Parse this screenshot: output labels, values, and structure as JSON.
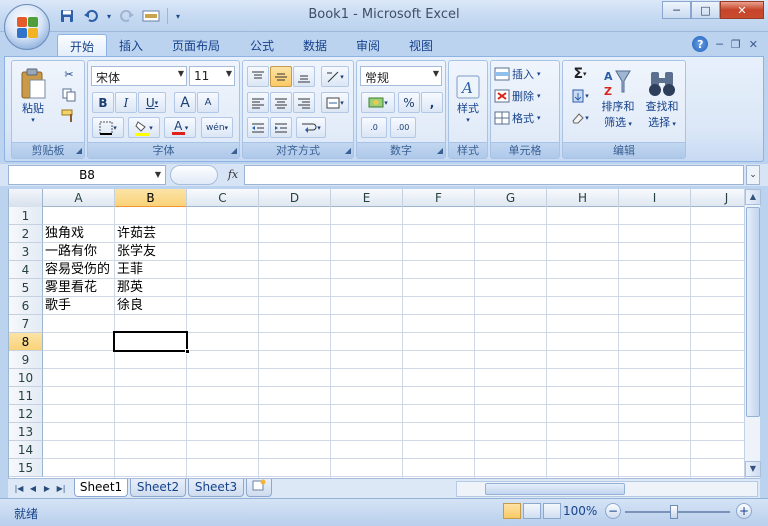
{
  "window": {
    "title": "Book1 - Microsoft Excel"
  },
  "quick_access": {
    "undo_arrow": "▾",
    "customize_arrow": "▾"
  },
  "window_controls": {
    "minimize": "─",
    "restore": "□",
    "close": "✕"
  },
  "ribbon_tabs": [
    "开始",
    "插入",
    "页面布局",
    "公式",
    "数据",
    "审阅",
    "视图"
  ],
  "ribbon_right": {
    "help": "?",
    "minimize": "─",
    "restore": "❐",
    "close": "✕"
  },
  "groups": {
    "clipboard": {
      "label": "剪贴板",
      "paste": "粘贴"
    },
    "font": {
      "label": "字体",
      "font_name": "宋体",
      "font_size": "11",
      "bold": "B",
      "italic": "I",
      "underline": "U",
      "grow": "A",
      "shrink": "A",
      "phonetic": "wén"
    },
    "alignment": {
      "label": "对齐方式"
    },
    "number": {
      "label": "数字",
      "format": "常规",
      "percent": "%",
      "comma": ",",
      "inc_decimal": ".0",
      "dec_decimal": ".00"
    },
    "styles": {
      "label": "样式",
      "button": "样式"
    },
    "cells": {
      "label": "单元格",
      "insert": "插入",
      "delete": "删除",
      "format": "格式"
    },
    "editing": {
      "label": "编辑",
      "sort_filter": "排序和",
      "sort_filter_2": "筛选",
      "find_select": "查找和",
      "find_select_2": "选择",
      "sigma": "Σ"
    }
  },
  "formula_bar": {
    "name_box": "B8",
    "fx": "fx",
    "content": ""
  },
  "grid": {
    "columns": [
      "A",
      "B",
      "C",
      "D",
      "E",
      "F",
      "G",
      "H",
      "I",
      "J"
    ],
    "rows": [
      "1",
      "2",
      "3",
      "4",
      "5",
      "6",
      "7",
      "8",
      "9",
      "10",
      "11",
      "12",
      "13",
      "14",
      "15"
    ],
    "selected_cell": "B8",
    "cells": {
      "A2": "独角戏",
      "B2": "许茹芸",
      "A3": "一路有你",
      "B3": "张学友",
      "A4": "容易受伤的",
      "B4": "王菲",
      "A5": "雾里看花",
      "B5": "那英",
      "A6": "歌手",
      "B6": "徐良"
    }
  },
  "sheets": [
    "Sheet1",
    "Sheet2",
    "Sheet3"
  ],
  "active_sheet": "Sheet1",
  "status_bar": {
    "ready": "就绪",
    "zoom": "100%",
    "zoom_out": "−",
    "zoom_in": "+"
  }
}
